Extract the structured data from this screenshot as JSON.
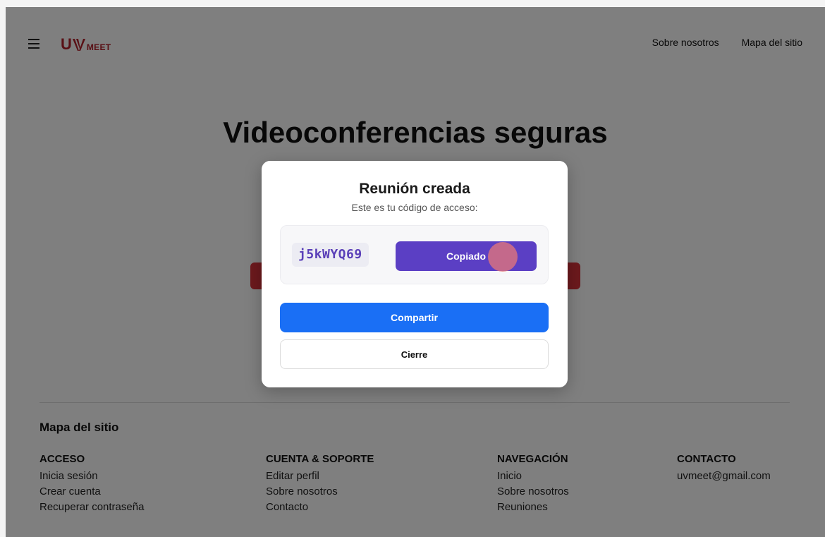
{
  "header": {
    "logo_u": "U",
    "logo_meet": "MEET",
    "nav": [
      "Sobre nosotros",
      "Mapa del sitio"
    ]
  },
  "hero": {
    "title": "Videoconferencias seguras"
  },
  "footer": {
    "title": "Mapa del sitio",
    "columns": [
      {
        "heading": "ACCESO",
        "links": [
          "Inicia sesión",
          "Crear cuenta",
          "Recuperar contraseña"
        ]
      },
      {
        "heading": "CUENTA & SOPORTE",
        "links": [
          "Editar perfil",
          "Sobre nosotros",
          "Contacto"
        ]
      },
      {
        "heading": "NAVEGACIÓN",
        "links": [
          "Inicio",
          "Sobre nosotros",
          "Reuniones"
        ]
      },
      {
        "heading": "CONTACTO",
        "links": [
          "uvmeet@gmail.com"
        ]
      }
    ]
  },
  "modal": {
    "title": "Reunión creada",
    "subtitle": "Este es tu código de acceso:",
    "code": "j5kWYQ69",
    "copy_label": "Copiado",
    "share_label": "Compartir",
    "close_label": "Cierre"
  },
  "colors": {
    "brand": "#b3202a",
    "copy_button": "#5b3fc4",
    "share_button": "#1a6ff5",
    "code_text": "#5a3fb8"
  },
  "icons": [
    "menu-icon",
    "uvmeet-logo"
  ]
}
